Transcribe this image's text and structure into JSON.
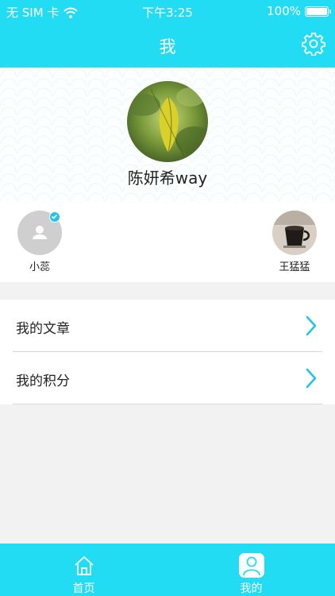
{
  "colors": {
    "accent": "#22dcf4",
    "background": "#f2f2f2"
  },
  "status_bar": {
    "carrier": "无 SIM 卡",
    "time": "下午3:25",
    "battery": "100%"
  },
  "nav": {
    "title": "我",
    "settings_icon": "gear-icon"
  },
  "profile": {
    "name": "陈妍希way"
  },
  "contacts": [
    {
      "name": "小蕊",
      "verified": true
    },
    {
      "name": "王猛猛",
      "verified": false
    }
  ],
  "menu": [
    {
      "label": "我的文章"
    },
    {
      "label": "我的积分"
    }
  ],
  "tabs": [
    {
      "label": "首页",
      "icon": "home-icon"
    },
    {
      "label": "我的",
      "icon": "person-icon",
      "active": true
    }
  ]
}
